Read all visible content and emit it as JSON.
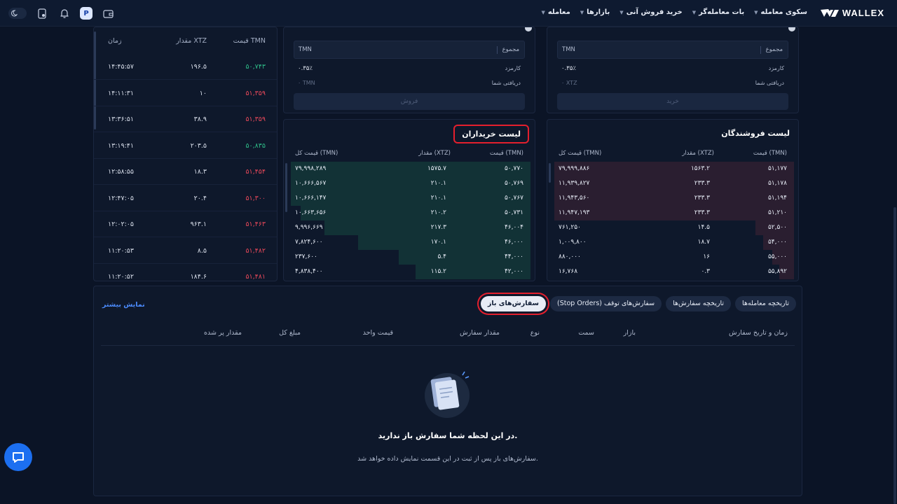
{
  "brand": {
    "name": "WALLEX"
  },
  "nav": {
    "items": [
      {
        "label": "معامله"
      },
      {
        "label": "بازارها"
      },
      {
        "label": "خرید فروش آنی"
      },
      {
        "label": "بات معامله‌گر"
      },
      {
        "label": "سکوی معامله"
      }
    ]
  },
  "header_icons": [
    "wallet-icon",
    "profile-icon",
    "bell-icon",
    "phone-icon",
    "moon-icon"
  ],
  "trades": {
    "headers": {
      "price": "قیمت TMN",
      "qty": "مقدار XTZ",
      "time": "زمان"
    },
    "rows": [
      {
        "price": "۵۰,۷۴۳",
        "qty": "۱۹۶.۵",
        "time": "۱۴:۴۵:۵۷",
        "side": "buy"
      },
      {
        "price": "۵۱,۳۵۹",
        "qty": "۱۰",
        "time": "۱۴:۱۱:۳۱",
        "side": "sell"
      },
      {
        "price": "۵۱,۳۵۹",
        "qty": "۳۸.۹",
        "time": "۱۳:۳۶:۵۱",
        "side": "sell"
      },
      {
        "price": "۵۰,۸۳۵",
        "qty": "۲۰۳.۵",
        "time": "۱۳:۱۹:۴۱",
        "side": "buy"
      },
      {
        "price": "۵۱,۴۵۴",
        "qty": "۱۸.۳",
        "time": "۱۲:۵۸:۵۵",
        "side": "sell"
      },
      {
        "price": "۵۱,۳۰۰",
        "qty": "۲۰.۴",
        "time": "۱۲:۴۷:۰۵",
        "side": "sell"
      },
      {
        "price": "۵۱,۴۶۳",
        "qty": "۹۶۳.۱",
        "time": "۱۲:۰۲:۰۵",
        "side": "sell"
      },
      {
        "price": "۵۱,۴۸۲",
        "qty": "۸.۵",
        "time": "۱۱:۲۰:۵۳",
        "side": "sell"
      },
      {
        "price": "۵۱,۴۸۱",
        "qty": "۱۸۴.۶",
        "time": "۱۱:۲۰:۵۲",
        "side": "sell"
      }
    ]
  },
  "sell_form": {
    "total_label": "مجموع",
    "currency": "TMN",
    "fee_label": "کارمزد",
    "fee_value": "۰.۳۵٪",
    "receive_label": "دریافتی شما",
    "receive_value": "۰ TMN",
    "button": "فروش"
  },
  "buy_form": {
    "total_label": "مجموع",
    "currency": "TMN",
    "fee_label": "کارمزد",
    "fee_value": "۰.۳۵٪",
    "receive_label": "دریافتی شما",
    "receive_value": "۰ XTZ",
    "button": "خرید"
  },
  "buyers": {
    "title": "لیست خریداران",
    "headers": {
      "price": "قیمت (TMN)",
      "qty": "مقدار (XTZ)",
      "total": "قیمت کل (TMN)"
    },
    "rows": [
      {
        "price": "۵۰,۷۷۰",
        "qty": "۱۵۷۵.۷",
        "total": "۷۹,۹۹۸,۲۸۹",
        "depth": 1.0
      },
      {
        "price": "۵۰,۷۶۹",
        "qty": "۲۱۰.۱",
        "total": "۱۰,۶۶۶,۵۶۷",
        "depth": 1.0
      },
      {
        "price": "۵۰,۷۶۷",
        "qty": "۲۱۰.۱",
        "total": "۱۰,۶۶۶,۱۴۷",
        "depth": 1.0
      },
      {
        "price": "۵۰,۷۳۱",
        "qty": "۲۱۰.۲",
        "total": "۱۰,۶۶۳,۶۵۶",
        "depth": 0.96
      },
      {
        "price": "۴۶,۰۰۴",
        "qty": "۲۱۷.۳",
        "total": "۹,۹۹۶,۶۶۹",
        "depth": 0.86
      },
      {
        "price": "۴۶,۰۰۰",
        "qty": "۱۷۰.۱",
        "total": "۷,۸۲۴,۶۰۰",
        "depth": 0.72
      },
      {
        "price": "۴۴,۰۰۰",
        "qty": "۵.۴",
        "total": "۲۳۷,۶۰۰",
        "depth": 0.55
      },
      {
        "price": "۴۲,۰۰۰",
        "qty": "۱۱۵.۲",
        "total": "۴,۸۳۸,۴۰۰",
        "depth": 0.48
      }
    ]
  },
  "sellers": {
    "title": "لیست فروشندگان",
    "headers": {
      "price": "قیمت (TMN)",
      "qty": "مقدار (XTZ)",
      "total": "قیمت کل (TMN)"
    },
    "rows": [
      {
        "price": "۵۱,۱۷۷",
        "qty": "۱۵۶۳.۲",
        "total": "۷۹,۹۹۹,۸۸۶",
        "depth": 1.0
      },
      {
        "price": "۵۱,۱۷۸",
        "qty": "۲۳۳.۳",
        "total": "۱۱,۹۳۹,۸۲۷",
        "depth": 1.0
      },
      {
        "price": "۵۱,۱۹۴",
        "qty": "۲۳۳.۳",
        "total": "۱۱,۹۴۳,۵۶۰",
        "depth": 1.0
      },
      {
        "price": "۵۱,۲۱۰",
        "qty": "۲۳۳.۳",
        "total": "۱۱,۹۴۷,۱۹۳",
        "depth": 1.0
      },
      {
        "price": "۵۲,۵۰۰",
        "qty": "۱۴.۵",
        "total": "۷۶۱,۲۵۰",
        "depth": 0.16
      },
      {
        "price": "۵۴,۰۰۰",
        "qty": "۱۸.۷",
        "total": "۱,۰۰۹,۸۰۰",
        "depth": 0.13
      },
      {
        "price": "۵۵,۰۰۰",
        "qty": "۱۶",
        "total": "۸۸۰,۰۰۰",
        "depth": 0.09
      },
      {
        "price": "۵۵,۸۹۲",
        "qty": "۰.۳",
        "total": "۱۶,۷۶۸",
        "depth": 0.06
      }
    ]
  },
  "orders": {
    "tabs": [
      {
        "label": "سفارش‌های باز",
        "active": true
      },
      {
        "label": "سفارش‌های توقف (Stop Orders)",
        "active": false
      },
      {
        "label": "تاریخچه سفارش‌ها",
        "active": false
      },
      {
        "label": "تاریخچه معامله‌ها",
        "active": false
      }
    ],
    "more": "نمایش بیشتر",
    "columns": [
      "زمان و تاریخ سفارش",
      "بازار",
      "سمت",
      "نوع",
      "مقدار سفارش",
      "قیمت واحد",
      "مبلغ کل",
      "مقدار پر شده"
    ],
    "empty_title": "در این لحظه شما سفارش باز ندارید.",
    "empty_sub": "سفارش‌های باز پس از ثبت در این قسمت نمایش داده خواهد شد."
  },
  "colors": {
    "buy": "#2fbf8a",
    "sell": "#e8485a",
    "highlight": "#e41f2d",
    "accent": "#4c8cff"
  }
}
